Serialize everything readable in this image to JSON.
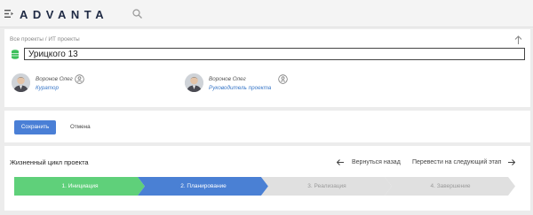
{
  "header": {
    "logo_text": "ADVANTA",
    "menu_icon": "menu-collapse-icon",
    "search_icon": "search-icon"
  },
  "project": {
    "breadcrumb": "Все проекты / ИТ проекты",
    "name_value": "Урицкого 13",
    "status_color": "#3cc05a",
    "people": [
      {
        "name": "Воронов Олег",
        "role": "Куратор",
        "icon": "user-switch-icon"
      },
      {
        "name": "Воронов Олег",
        "role": "Руководитель проекта",
        "icon": "user-switch-icon"
      }
    ]
  },
  "actions": {
    "save_label": "Сохранить",
    "cancel_label": "Отмена"
  },
  "lifecycle": {
    "title": "Жизненный цикл проекта",
    "back_label": "Вернуться назад",
    "next_label": "Перевести на следующий этап",
    "stages": [
      {
        "label": "1. Инициация",
        "color": "#5fd07a",
        "text_color": "#ffffff"
      },
      {
        "label": "2. Планирование",
        "color": "#4a80d4",
        "text_color": "#ffffff"
      },
      {
        "label": "3. Реализация",
        "color": "#e0e0e0",
        "text_color": "#9a9a9a"
      },
      {
        "label": "4. Завершение",
        "color": "#e0e0e0",
        "text_color": "#9a9a9a"
      }
    ]
  },
  "colors": {
    "accent": "#4a7fd6",
    "link": "#3a78c8"
  }
}
